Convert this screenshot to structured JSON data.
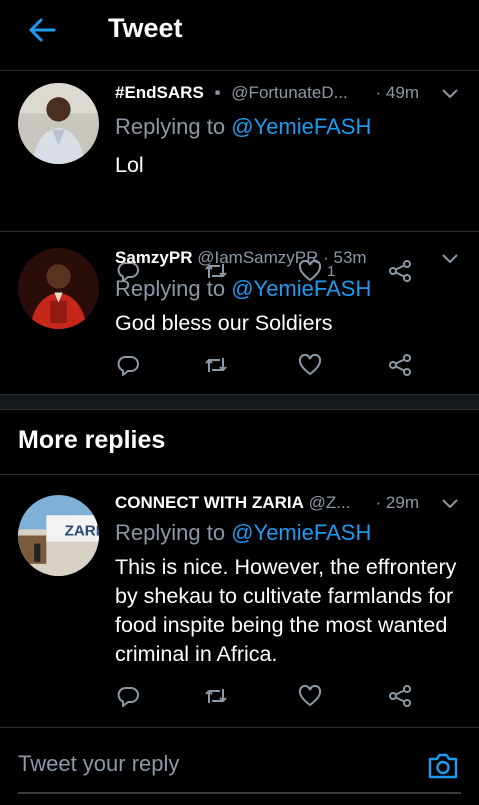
{
  "header": {
    "title": "Tweet"
  },
  "replies": [
    {
      "name": "#EndSARS",
      "badge": "▪",
      "handle": "@FortunateD...",
      "time": "· 49m",
      "replying_prefix": "Replying to",
      "replying_to": "@YemieFASH",
      "text": "Lol",
      "like_count": "1"
    },
    {
      "name": "SamzyPR",
      "handle": "@IamSamzyPR",
      "time": "· 53m",
      "replying_prefix": "Replying to",
      "replying_to": "@YemieFASH",
      "text": "God bless our Soldiers",
      "like_count": ""
    }
  ],
  "more_replies": {
    "title": "More replies",
    "items": [
      {
        "name": "CONNECT WITH ZARIA",
        "handle": "@Z...",
        "time": "· 29m",
        "replying_prefix": "Replying to",
        "replying_to": "@YemieFASH",
        "text": "This is nice. However, the effrontery by shekau to cultivate farmlands for food inspite being the most wanted criminal in Africa.",
        "like_count": "",
        "avatar_text": "ZARI"
      }
    ]
  },
  "reply_bar": {
    "placeholder": "Tweet your reply"
  },
  "colors": {
    "background": "#000000",
    "accent": "#1d9bf0",
    "muted": "#8b98a5",
    "divider": "#2a2f33"
  }
}
